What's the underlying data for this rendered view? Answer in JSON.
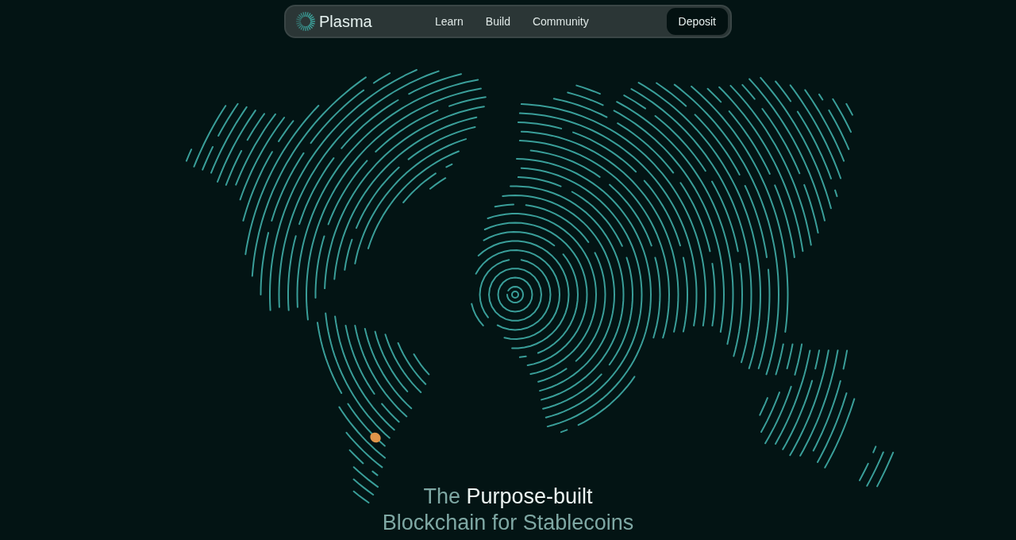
{
  "nav": {
    "brand": "Plasma",
    "links": [
      {
        "label": "Learn"
      },
      {
        "label": "Build"
      },
      {
        "label": "Community"
      }
    ],
    "cta": "Deposit"
  },
  "hero": {
    "lead": "The",
    "highlight": "Purpose-built",
    "line2": "Blockchain for Stablecoins"
  }
}
